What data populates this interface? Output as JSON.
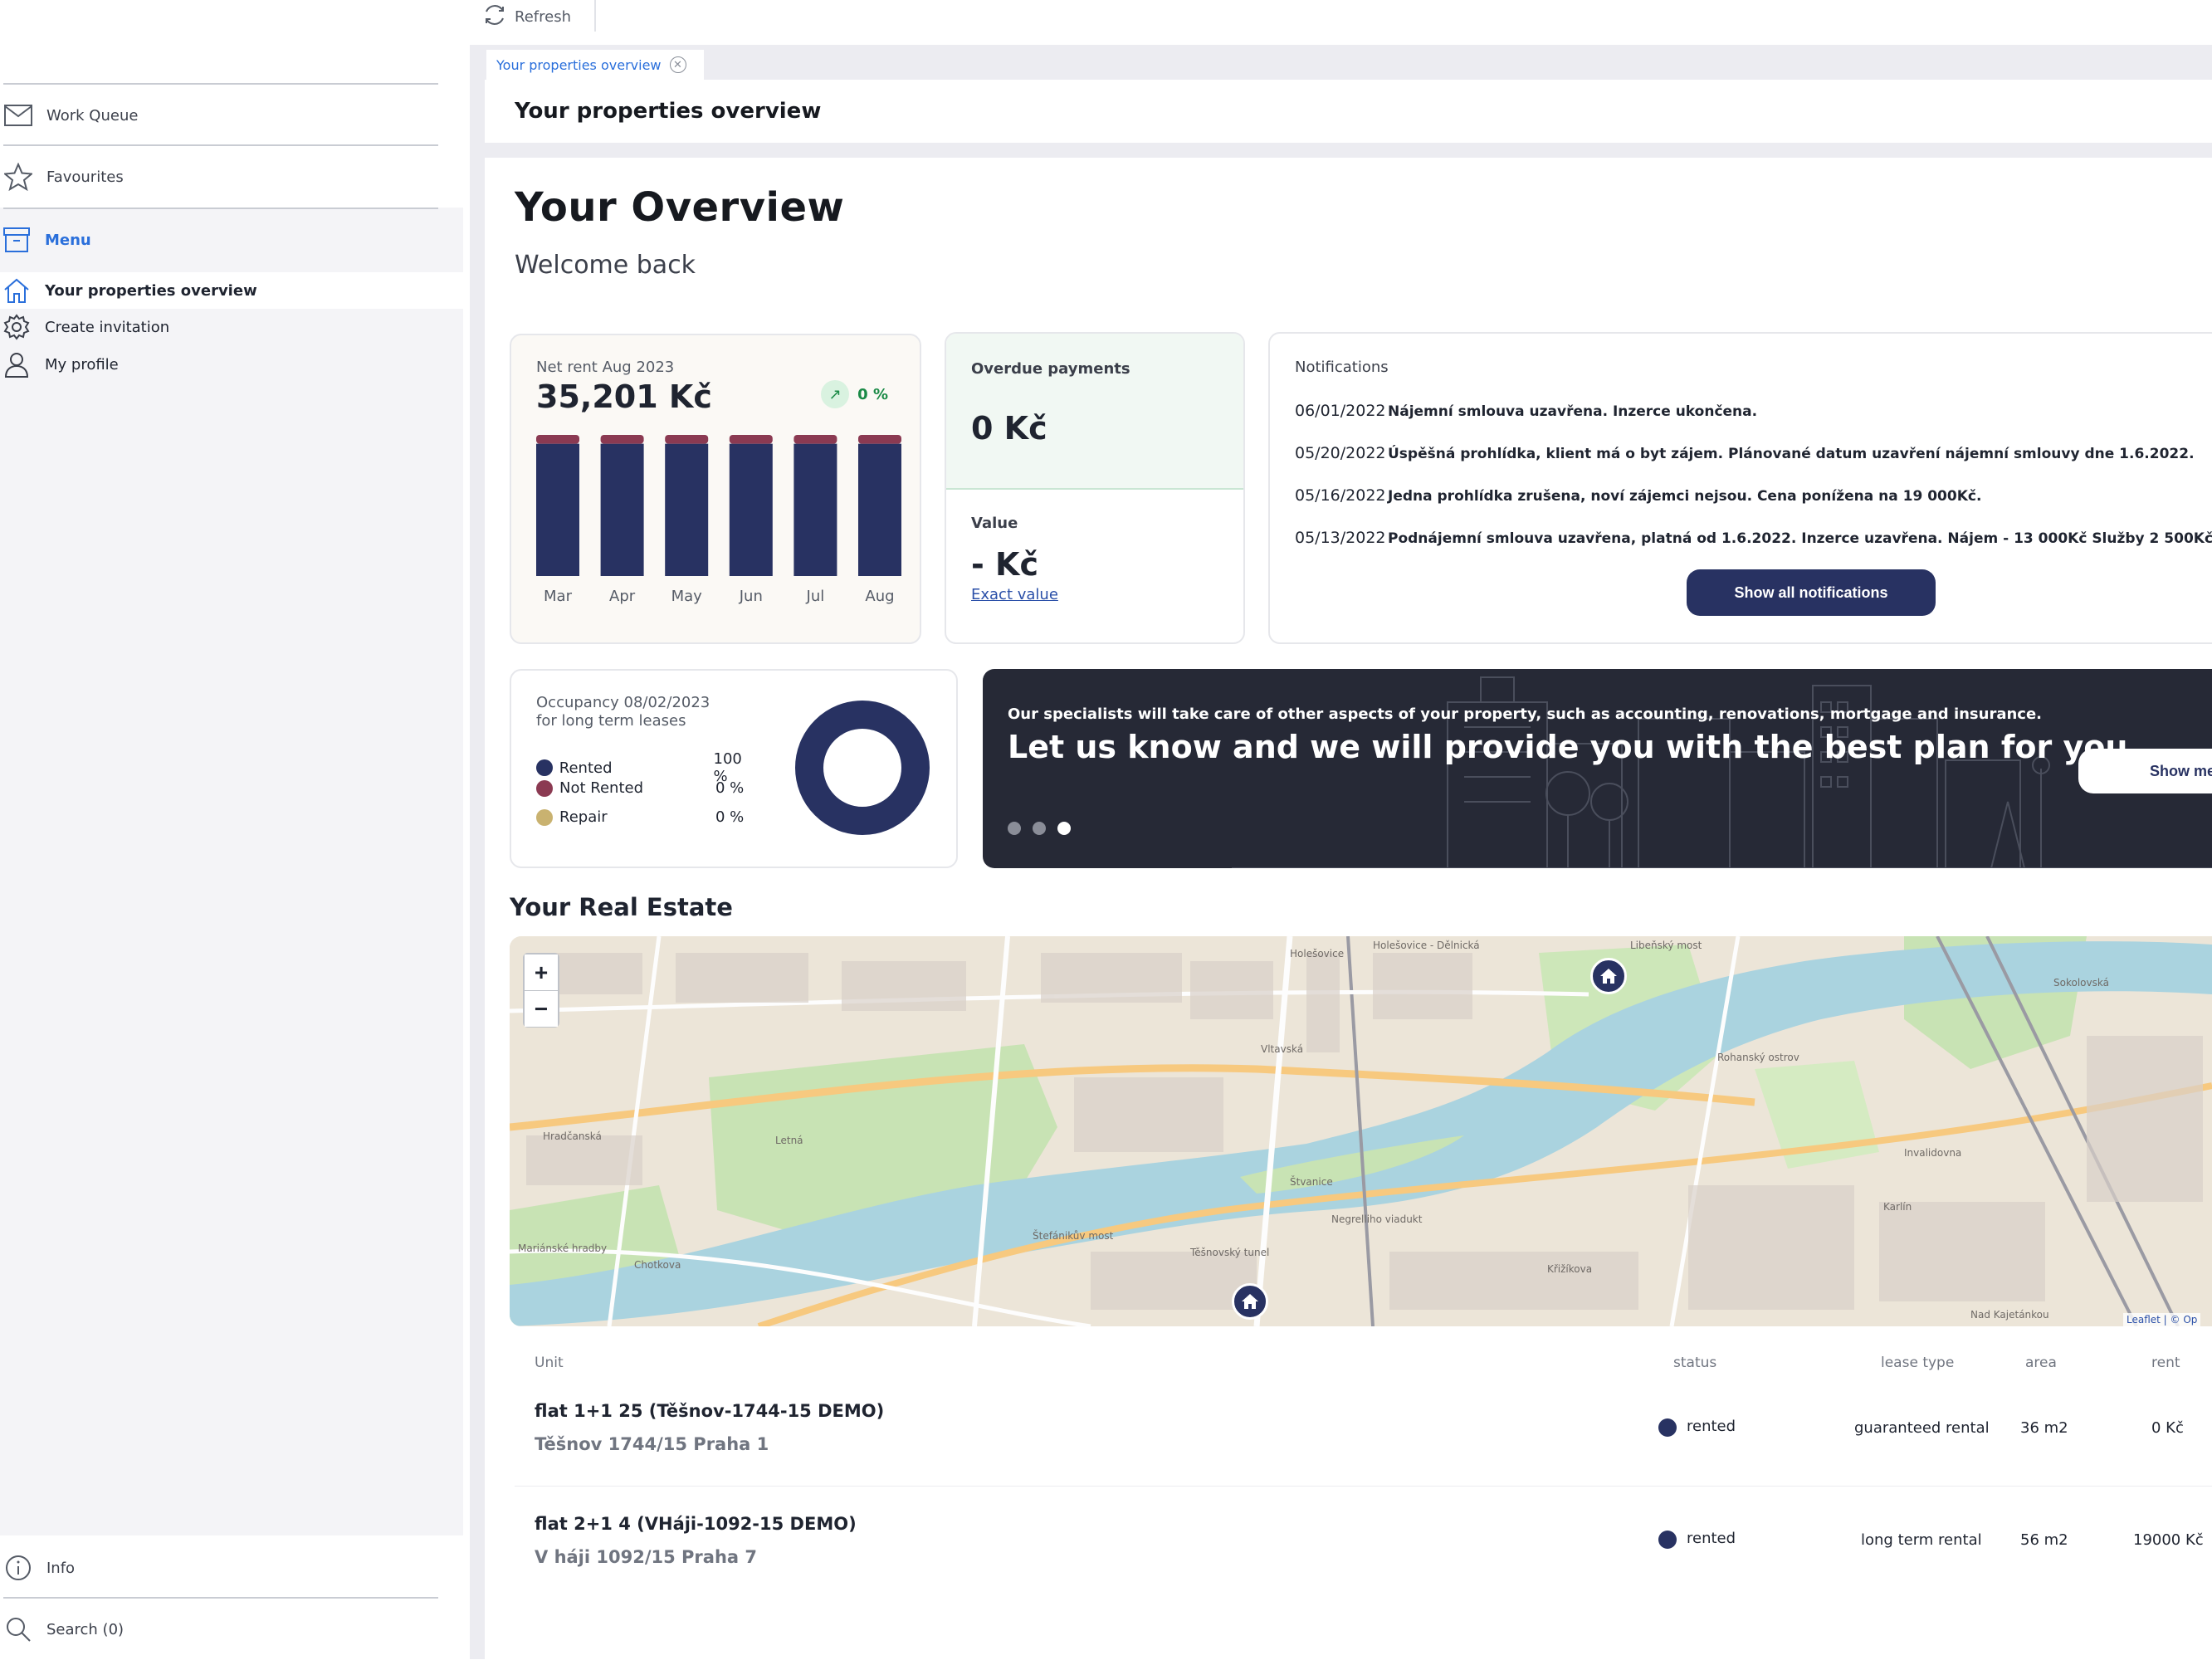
{
  "colors": {
    "accent": "#2a6fdb",
    "navy": "#283262",
    "rented": "#283262",
    "not_rented": "#8b3a52",
    "repair": "#c9b270",
    "success": "#1a8a46"
  },
  "sidebar": {
    "work_queue": "Work Queue",
    "favourites": "Favourites",
    "menu": "Menu",
    "items": [
      {
        "label": "Your properties overview",
        "icon": "home-icon"
      },
      {
        "label": "Create invitation",
        "icon": "gear-icon"
      },
      {
        "label": "My profile",
        "icon": "user-icon"
      }
    ],
    "info": "Info",
    "search": "Search (0)"
  },
  "toolbar": {
    "refresh": "Refresh"
  },
  "tab": {
    "label": "Your properties overview"
  },
  "page": {
    "title": "Your properties overview",
    "heading": "Your Overview",
    "welcome": "Welcome back"
  },
  "rent": {
    "title": "Net rent Aug 2023",
    "value": "35,201 Kč",
    "trend": "0 %",
    "chart_data": {
      "type": "bar",
      "categories": [
        "Mar",
        "Apr",
        "May",
        "Jun",
        "Jul",
        "Aug"
      ],
      "series": [
        {
          "values": [
            33000,
            33000,
            33000,
            33000,
            33000,
            33000
          ]
        },
        {
          "values": [
            2201,
            2201,
            2201,
            2201,
            2201,
            2201
          ]
        }
      ]
    }
  },
  "overdue": {
    "title": "Overdue payments",
    "value": "0 Kč"
  },
  "estimate": {
    "title": "Value",
    "value": "- Kč",
    "link": "Exact value"
  },
  "notifications": {
    "title": "Notifications",
    "items": [
      {
        "date": "06/01/2022",
        "text": "Nájemní smlouva uzavřena. Inzerce ukončena."
      },
      {
        "date": "05/20/2022",
        "text": "Úspěšná prohlídka, klient má o byt zájem. Plánované datum uzavření nájemní smlouvy dne 1.6.2022."
      },
      {
        "date": "05/16/2022",
        "text": "Jedna prohlídka zrušena, noví zájemci nejsou. Cena ponížena na 19 000Kč."
      },
      {
        "date": "05/13/2022",
        "text": "Podnájemní smlouva uzavřena, platná od 1.6.2022. Inzerce uzavřena. Nájem - 13 000Kč Služby 2 500Kč."
      }
    ],
    "button": "Show all notifications"
  },
  "occupancy": {
    "title_line1": "Occupancy 08/02/2023",
    "title_line2": "for long term leases",
    "rows": [
      {
        "label": "Rented",
        "value": "100 %"
      },
      {
        "label": "Not Rented",
        "value": "0 %"
      },
      {
        "label": "Repair",
        "value": "0 %"
      }
    ],
    "fractions": {
      "rented": 1.0,
      "not_rented": 0.0,
      "repair": 0.0
    }
  },
  "banner": {
    "subtitle": "Our specialists will take care of other aspects of your property, such as accounting, renovations, mortgage and insurance.",
    "headline": "Let us know and we will provide you with the best plan for you.",
    "button": "Show me",
    "active_slide": 3,
    "slide_count": 3
  },
  "real_estate": {
    "heading": "Your Real Estate",
    "map": {
      "zoom_in": "+",
      "zoom_out": "−",
      "attribution": "Leaflet | © Op",
      "labels": [
        "Holešovice",
        "Vltavská",
        "Štvanice",
        "Rohanský ostrov",
        "Karlín",
        "Invalidovna",
        "Letná",
        "Hradčanská",
        "Těšnovský tunel",
        "Negrelliho viadukt",
        "Štefánikův most",
        "Křižíkova",
        "Sokolovská",
        "Libeňský most",
        "Nad Kajetánkou",
        "Mariánské hradby",
        "Chotkova",
        "Holešovice - Dělnická"
      ]
    },
    "columns": {
      "unit": "Unit",
      "status": "status",
      "lease": "lease type",
      "area": "area",
      "rent": "rent"
    },
    "rows": [
      {
        "name": "flat 1+1 25 (Těšnov-1744-15 DEMO)",
        "address": "Těšnov 1744/15 Praha 1",
        "status": "rented",
        "lease": "guaranteed rental",
        "area": "36 m2",
        "rent": "0 Kč"
      },
      {
        "name": "flat 2+1 4 (VHáji-1092-15 DEMO)",
        "address": "V háji 1092/15 Praha 7",
        "status": "rented",
        "lease": "long term rental",
        "area": "56 m2",
        "rent": "19000 Kč"
      }
    ]
  }
}
